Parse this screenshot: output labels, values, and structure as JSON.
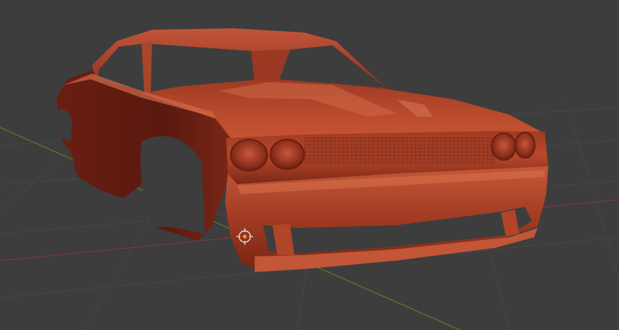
{
  "viewport": {
    "background": "#3d3d3d",
    "grid_line_color": "#4a4a4a",
    "x_axis_color": "#8a3f46",
    "y_axis_color": "#6f8f2f",
    "grid_visible": true
  },
  "object": {
    "kind": "car-body-mesh",
    "material_color": "#b54a2c",
    "shading": "smooth"
  },
  "gizmos": {
    "origin_icon": "object-origin-icon",
    "origin_color": "#f0a040"
  }
}
